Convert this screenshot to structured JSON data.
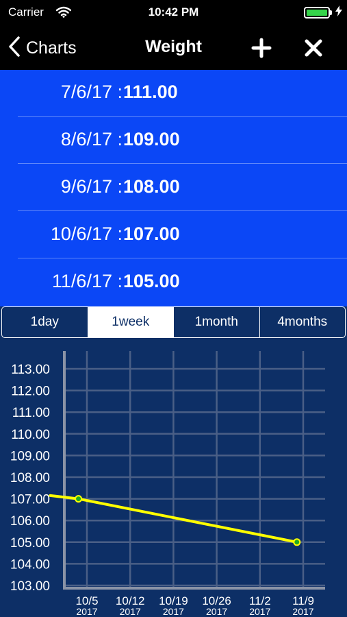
{
  "status_bar": {
    "carrier": "Carrier",
    "time": "10:42 PM",
    "battery_level": 1.0,
    "battery_color": "#35d34a",
    "wifi_icon": "wifi-icon",
    "charging_icon": "bolt-icon"
  },
  "nav": {
    "back_label": "Charts",
    "title": "Weight",
    "back_icon": "chevron-left-icon",
    "add_icon": "plus-icon",
    "close_icon": "close-icon"
  },
  "entries": [
    {
      "date": "7/6/17 :",
      "value": "111.00"
    },
    {
      "date": "8/6/17 :",
      "value": "109.00"
    },
    {
      "date": "9/6/17 :",
      "value": "108.00"
    },
    {
      "date": "10/6/17 :",
      "value": "107.00"
    },
    {
      "date": "11/6/17 :",
      "value": "105.00"
    }
  ],
  "segments": {
    "tabs": [
      "1day",
      "1week",
      "1month",
      "4months"
    ],
    "selected": "1week"
  },
  "colors": {
    "list_bg": "#0b47f6",
    "chart_bg": "#0d2f66",
    "line": "#ffff00",
    "point": "#22aa22"
  },
  "chart_data": {
    "type": "line",
    "y_ticks": [
      "113.00",
      "112.00",
      "111.00",
      "110.00",
      "109.00",
      "108.00",
      "107.00",
      "106.00",
      "105.00",
      "104.00",
      "103.00"
    ],
    "ylim": [
      103,
      113
    ],
    "x_ticks": [
      {
        "date": "10/5",
        "year": "2017"
      },
      {
        "date": "10/12",
        "year": "2017"
      },
      {
        "date": "10/19",
        "year": "2017"
      },
      {
        "date": "10/26",
        "year": "2017"
      },
      {
        "date": "11/2",
        "year": "2017"
      },
      {
        "date": "11/9",
        "year": "2017"
      }
    ],
    "xlim": [
      "2017-10-04",
      "2017-11-10"
    ],
    "series": [
      {
        "points": [
          {
            "x": "2017-10-02",
            "y": 107.15,
            "marker": false
          },
          {
            "x": "2017-10-06",
            "y": 107.0,
            "marker": true
          },
          {
            "x": "2017-11-06",
            "y": 105.0,
            "marker": true
          }
        ]
      }
    ],
    "grid": true
  }
}
